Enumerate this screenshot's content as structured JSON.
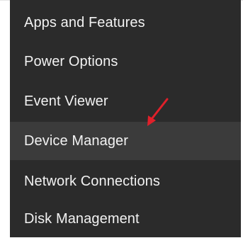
{
  "context_menu": {
    "items": [
      {
        "label": "Apps and Features"
      },
      {
        "label": "Power Options"
      },
      {
        "label": "Event Viewer"
      },
      {
        "label": "Device Manager",
        "hovered": true
      },
      {
        "label": "Network Connections"
      },
      {
        "label": "Disk Management"
      }
    ]
  },
  "annotation": {
    "arrow_color": "#e0202a",
    "icon": "red-arrow-icon"
  },
  "colors": {
    "menu_background": "#2b2b2b",
    "hover_background": "#3b3b3b",
    "text": "#f2f2f2"
  }
}
